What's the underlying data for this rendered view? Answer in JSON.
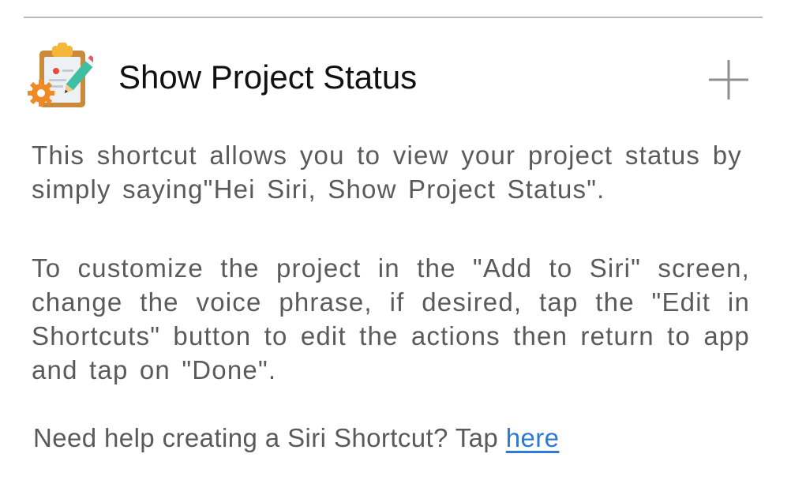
{
  "shortcut": {
    "title": "Show Project Status",
    "icon": "clipboard-pencil-gear-icon",
    "add_icon": "plus-icon",
    "description_1": "This shortcut allows you to view your project status by simply saying\"Hei Siri, Show Project Status\".",
    "description_2": "To customize the project in the \"Add to Siri\" screen, change the voice phrase, if desired, tap the \"Edit in Shortcuts\" button to edit the actions then return to app and tap on \"Done\"."
  },
  "help": {
    "prompt": "Need help creating a Siri Shortcut? Tap ",
    "link_label": "here"
  },
  "colors": {
    "link": "#2c7ad6",
    "body_text": "#5a5a5e",
    "title_text": "#111111",
    "divider": "#b9b9bc"
  }
}
